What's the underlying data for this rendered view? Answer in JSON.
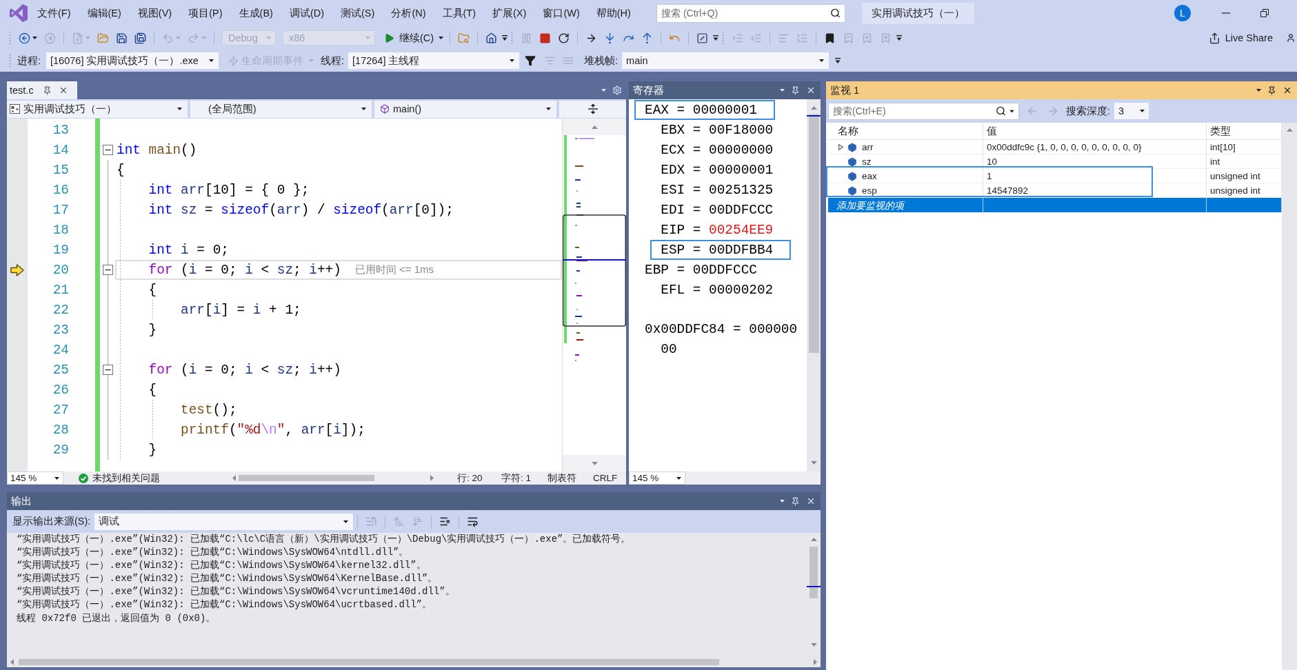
{
  "window": {
    "title": "实用调试技巧（一）",
    "user_initial": "L"
  },
  "menu": [
    "文件(F)",
    "编辑(E)",
    "视图(V)",
    "项目(P)",
    "生成(B)",
    "调试(D)",
    "测试(S)",
    "分析(N)",
    "工具(T)",
    "扩展(X)",
    "窗口(W)",
    "帮助(H)"
  ],
  "search": {
    "placeholder": "搜索 (Ctrl+Q)"
  },
  "toolbar": {
    "groups": [
      [
        {
          "kind": "icon",
          "disabled": false,
          "menu": true
        },
        {
          "kind": "icon",
          "disabled": true,
          "menu": false
        }
      ],
      [
        {
          "kind": "icon",
          "disabled": true,
          "menu": true
        },
        {
          "kind": "icon",
          "disabled": false,
          "menu": false
        },
        {
          "kind": "icon",
          "disabled": false,
          "menu": false
        },
        {
          "kind": "icon",
          "disabled": false,
          "menu": false
        }
      ],
      [
        {
          "kind": "icon",
          "disabled": true,
          "menu": true
        },
        {
          "kind": "icon",
          "disabled": true,
          "menu": true
        }
      ],
      [
        {
          "kind": "dropdown",
          "value": "Debug",
          "disabled": true
        },
        {
          "kind": "dropdown",
          "value": "x86",
          "disabled": true
        },
        {
          "kind": "run",
          "label": "继续(C)",
          "disabled": false,
          "menu": true
        }
      ],
      [
        {
          "kind": "icon",
          "disabled": false,
          "menu": false
        }
      ],
      [
        {
          "kind": "icon",
          "disabled": false,
          "menu": false
        },
        {
          "kind": "overflow"
        }
      ],
      [
        {
          "kind": "icon",
          "disabled": true,
          "menu": false
        },
        {
          "kind": "icon",
          "disabled": false,
          "menu": false
        },
        {
          "kind": "icon",
          "disabled": false,
          "menu": false
        }
      ],
      [
        {
          "kind": "icon",
          "disabled": false,
          "menu": false
        },
        {
          "kind": "icon",
          "disabled": false,
          "menu": false
        },
        {
          "kind": "icon",
          "disabled": false,
          "menu": false
        },
        {
          "kind": "icon",
          "disabled": false,
          "menu": false
        }
      ],
      [
        {
          "kind": "icon",
          "disabled": false,
          "menu": false
        }
      ],
      [
        {
          "kind": "icon",
          "disabled": false,
          "menu": false
        },
        {
          "kind": "overflow"
        }
      ],
      [
        {
          "kind": "icon",
          "disabled": true,
          "menu": false
        },
        {
          "kind": "icon",
          "disabled": true,
          "menu": false
        }
      ],
      [
        {
          "kind": "icon",
          "disabled": true,
          "menu": false
        },
        {
          "kind": "icon",
          "disabled": true,
          "menu": false
        }
      ],
      [
        {
          "kind": "icon",
          "disabled": false,
          "menu": false
        },
        {
          "kind": "icon",
          "disabled": true,
          "menu": false
        },
        {
          "kind": "icon",
          "disabled": true,
          "menu": false
        },
        {
          "kind": "icon",
          "disabled": true,
          "menu": false
        },
        {
          "kind": "overflow"
        }
      ]
    ],
    "live_share": "Live Share"
  },
  "debug_bar": {
    "process_label": "进程:",
    "process": "[16076] 实用调试技巧（一）.exe",
    "lifecycle": {
      "label": "生命周期事件",
      "disabled": true
    },
    "thread_label": "线程:",
    "thread": "[17264] 主线程",
    "thread_tools": [
      {
        "disabled": false
      },
      {
        "disabled": true
      },
      {
        "disabled": true
      }
    ],
    "stack_label": "堆栈帧:",
    "stack_frame": "main",
    "overflow": true
  },
  "editor": {
    "tab": {
      "label": "test.c",
      "selected": true
    },
    "modified": true,
    "navigation": {
      "project": "实用调试技巧（一）",
      "scope": "(全局范围)",
      "member": "main()"
    },
    "lines": [
      {
        "number": "13",
        "collapsible": false,
        "current": false
      },
      {
        "number": "14",
        "collapsible": true,
        "current": false,
        "tokens": [
          {
            "kind": "keyword",
            "text": "int"
          },
          {
            "kind": "function",
            "text": " main"
          },
          {
            "kind": "plain",
            "text": "()"
          }
        ]
      },
      {
        "number": "15",
        "collapsible": false,
        "current": false,
        "tokens": [
          {
            "kind": "plain",
            "text": "{"
          }
        ],
        "children": [
          {
            "number": "16",
            "collapsible": false,
            "current": false,
            "tokens": [
              {
                "kind": "keyword",
                "text": "int"
              },
              {
                "kind": "local",
                "text": " arr"
              },
              {
                "kind": "plain",
                "text": "["
              },
              {
                "kind": "number",
                "text": "10"
              },
              {
                "kind": "plain",
                "text": "] = { "
              },
              {
                "kind": "number",
                "text": "0"
              },
              {
                "kind": "plain",
                "text": " };"
              }
            ]
          },
          {
            "number": "17",
            "collapsible": false,
            "current": false,
            "tokens": [
              {
                "kind": "keyword",
                "text": "int"
              },
              {
                "kind": "local",
                "text": " sz"
              },
              {
                "kind": "plain",
                "text": " = "
              },
              {
                "kind": "keyword",
                "text": "sizeof"
              },
              {
                "kind": "plain",
                "text": "("
              },
              {
                "kind": "local",
                "text": "arr"
              },
              {
                "kind": "plain",
                "text": ") / "
              },
              {
                "kind": "keyword",
                "text": "sizeof"
              },
              {
                "kind": "plain",
                "text": "("
              },
              {
                "kind": "local",
                "text": "arr"
              },
              {
                "kind": "plain",
                "text": "["
              },
              {
                "kind": "number",
                "text": "0"
              },
              {
                "kind": "plain",
                "text": "]);"
              }
            ]
          },
          {
            "number": "18",
            "collapsible": false,
            "current": false
          },
          {
            "number": "19",
            "collapsible": false,
            "current": false,
            "tokens": [
              {
                "kind": "keyword",
                "text": "int"
              },
              {
                "kind": "local",
                "text": " i"
              },
              {
                "kind": "plain",
                "text": " = "
              },
              {
                "kind": "number",
                "text": "0"
              },
              {
                "kind": "plain",
                "text": ";"
              }
            ]
          },
          {
            "number": "20",
            "collapsible": true,
            "current": true,
            "hint": "已用时间 <= 1ms",
            "tokens": [
              {
                "kind": "control",
                "text": "for"
              },
              {
                "kind": "plain",
                "text": " ("
              },
              {
                "kind": "local",
                "text": "i"
              },
              {
                "kind": "plain",
                "text": " = "
              },
              {
                "kind": "number",
                "text": "0"
              },
              {
                "kind": "plain",
                "text": "; "
              },
              {
                "kind": "local",
                "text": "i"
              },
              {
                "kind": "plain",
                "text": " < "
              },
              {
                "kind": "local",
                "text": "sz"
              },
              {
                "kind": "plain",
                "text": "; "
              },
              {
                "kind": "local",
                "text": "i"
              },
              {
                "kind": "plain",
                "text": "++)"
              }
            ]
          },
          {
            "number": "21",
            "collapsible": false,
            "current": false,
            "tokens": [
              {
                "kind": "plain",
                "text": "{"
              }
            ],
            "children": [
              {
                "number": "22",
                "collapsible": false,
                "current": false,
                "tokens": [
                  {
                    "kind": "local",
                    "text": "arr"
                  },
                  {
                    "kind": "plain",
                    "text": "["
                  },
                  {
                    "kind": "local",
                    "text": "i"
                  },
                  {
                    "kind": "plain",
                    "text": "] = "
                  },
                  {
                    "kind": "local",
                    "text": "i"
                  },
                  {
                    "kind": "plain",
                    "text": " + "
                  },
                  {
                    "kind": "number",
                    "text": "1"
                  },
                  {
                    "kind": "plain",
                    "text": ";"
                  }
                ]
              }
            ]
          },
          {
            "number": "23",
            "collapsible": false,
            "current": false,
            "tokens": [
              {
                "kind": "plain",
                "text": "}"
              }
            ]
          },
          {
            "number": "24",
            "collapsible": false,
            "current": false
          },
          {
            "number": "25",
            "collapsible": true,
            "current": false,
            "tokens": [
              {
                "kind": "control",
                "text": "for"
              },
              {
                "kind": "plain",
                "text": " ("
              },
              {
                "kind": "local",
                "text": "i"
              },
              {
                "kind": "plain",
                "text": " = "
              },
              {
                "kind": "number",
                "text": "0"
              },
              {
                "kind": "plain",
                "text": "; "
              },
              {
                "kind": "local",
                "text": "i"
              },
              {
                "kind": "plain",
                "text": " < "
              },
              {
                "kind": "local",
                "text": "sz"
              },
              {
                "kind": "plain",
                "text": "; "
              },
              {
                "kind": "local",
                "text": "i"
              },
              {
                "kind": "plain",
                "text": "++)"
              }
            ]
          },
          {
            "number": "26",
            "collapsible": false,
            "current": false,
            "tokens": [
              {
                "kind": "plain",
                "text": "{"
              }
            ],
            "children": [
              {
                "number": "27",
                "collapsible": false,
                "current": false,
                "tokens": [
                  {
                    "kind": "function",
                    "text": "test"
                  },
                  {
                    "kind": "plain",
                    "text": "();"
                  }
                ]
              },
              {
                "number": "28",
                "collapsible": false,
                "current": false,
                "tokens": [
                  {
                    "kind": "function",
                    "text": "printf"
                  },
                  {
                    "kind": "plain",
                    "text": "("
                  },
                  {
                    "kind": "string",
                    "text": "\"%d"
                  },
                  {
                    "kind": "escape",
                    "text": "\\n"
                  },
                  {
                    "kind": "string",
                    "text": "\""
                  },
                  {
                    "kind": "plain",
                    "text": ", "
                  },
                  {
                    "kind": "local",
                    "text": "arr"
                  },
                  {
                    "kind": "plain",
                    "text": "["
                  },
                  {
                    "kind": "local",
                    "text": "i"
                  },
                  {
                    "kind": "plain",
                    "text": "]);"
                  }
                ]
              }
            ]
          },
          {
            "number": "29",
            "collapsible": false,
            "current": false,
            "tokens": [
              {
                "kind": "plain",
                "text": "}"
              }
            ]
          }
        ]
      }
    ],
    "status": {
      "zoom": "145 %",
      "issues": "未找到相关问题",
      "line": "行: 20",
      "column": "字符: 1",
      "indent": "制表符",
      "line_ending": "CRLF"
    }
  },
  "registers": {
    "title": "寄存器",
    "active": false,
    "items": [
      {
        "label": "EAX =",
        "value": "00000001",
        "changed": false,
        "indented": false,
        "highlighted": true
      },
      {
        "label": "EBX =",
        "value": "00F18000",
        "changed": false,
        "indented": true,
        "highlighted": false
      },
      {
        "label": "ECX =",
        "value": "00000000",
        "changed": false,
        "indented": true,
        "highlighted": false
      },
      {
        "label": "EDX =",
        "value": "00000001",
        "changed": false,
        "indented": true,
        "highlighted": false
      },
      {
        "label": "ESI =",
        "value": "00251325",
        "changed": false,
        "indented": true,
        "highlighted": false
      },
      {
        "label": "EDI =",
        "value": "00DDFCCC",
        "changed": false,
        "indented": true,
        "highlighted": false
      },
      {
        "label": "EIP =",
        "value": "00254EE9",
        "changed": true,
        "indented": true,
        "highlighted": false
      },
      {
        "label": "ESP =",
        "value": "00DDFBB4",
        "changed": false,
        "indented": true,
        "highlighted": true
      },
      {
        "label": "EBP =",
        "value": "00DDFCCC",
        "changed": false,
        "indented": false,
        "highlighted": false
      },
      {
        "label": "EFL =",
        "value": "00000202",
        "changed": false,
        "indented": true,
        "highlighted": false
      }
    ],
    "memory": "0x00DDFC84 = 00000000",
    "zoom": "145 %"
  },
  "watch": {
    "title": "监视 1",
    "active": true,
    "search_placeholder": "搜索(Ctrl+E)",
    "history": [
      {
        "disabled": true
      },
      {
        "disabled": true
      }
    ],
    "depth_label": "搜索深度:",
    "depth": "3",
    "columns": [
      "名称",
      "值",
      "类型"
    ],
    "rows": [
      {
        "name": "arr",
        "value": "0x00ddfc9c {1, 0, 0, 0, 0, 0, 0, 0, 0, 0}",
        "type": "int[10]",
        "expandable": true,
        "selected": false,
        "highlighted": false
      },
      {
        "name": "sz",
        "value": "10",
        "type": "int",
        "expandable": false,
        "selected": false,
        "highlighted": false
      },
      {
        "name": "eax",
        "value": "1",
        "type": "unsigned int",
        "expandable": false,
        "selected": false,
        "highlighted": true
      },
      {
        "name": "esp",
        "value": "14547892",
        "type": "unsigned int",
        "expandable": false,
        "selected": false,
        "highlighted": true
      }
    ],
    "add_row": {
      "placeholder": "添加要监视的项",
      "selected": true
    }
  },
  "output": {
    "title": "输出",
    "active": false,
    "source_label": "显示输出来源(S):",
    "source": "调试",
    "tools": [
      {
        "disabled": true
      },
      {
        "disabled": true
      },
      {
        "disabled": true
      },
      {
        "disabled": false
      },
      {
        "disabled": false
      }
    ],
    "lines": [
      "“实用调试技巧（一）.exe”(Win32): 已加载“C:\\lc\\C语言（新）\\实用调试技巧（一）\\Debug\\实用调试技巧（一）.exe”。已加载符号。",
      "“实用调试技巧（一）.exe”(Win32): 已加载“C:\\Windows\\SysWOW64\\ntdll.dll”。",
      "“实用调试技巧（一）.exe”(Win32): 已加载“C:\\Windows\\SysWOW64\\kernel32.dll”。",
      "“实用调试技巧（一）.exe”(Win32): 已加载“C:\\Windows\\SysWOW64\\KernelBase.dll”。",
      "“实用调试技巧（一）.exe”(Win32): 已加载“C:\\Windows\\SysWOW64\\vcruntime140d.dll”。",
      "“实用调试技巧（一）.exe”(Win32): 已加载“C:\\Windows\\SysWOW64\\ucrtbased.dll”。",
      "线程 0x72f0 已退出，返回值为 0 (0x0)。"
    ]
  }
}
